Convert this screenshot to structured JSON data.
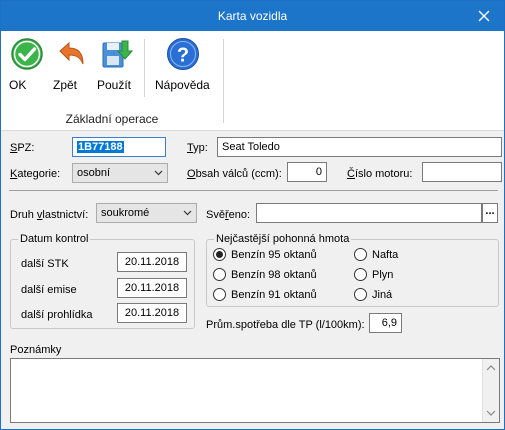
{
  "window": {
    "title": "Karta vozidla"
  },
  "toolbar": {
    "ok_label": "OK",
    "back_label": "Zpět",
    "apply_label": "Použít",
    "help_label": "Nápověda",
    "group_label": "Základní operace"
  },
  "form": {
    "spz_label": "SPZ:",
    "spz_value": "1B77188",
    "typ_label": "Typ:",
    "typ_value": "Seat Toledo",
    "kategorie_label": "Kategorie:",
    "kategorie_value": "osobní",
    "obsah_label": "Obsah válců (ccm):",
    "obsah_value": "0",
    "cislo_motoru_label": "Číslo motoru:",
    "cislo_motoru_value": "",
    "druh_label": "Druh vlastnictví:",
    "druh_value": "soukromé",
    "sevreno_label": "Svěřeno:",
    "sevreno_value": "",
    "ellipsis_label": "..."
  },
  "datum_kontrol": {
    "title": "Datum kontrol",
    "rows": [
      {
        "label": "další STK",
        "value": "20.11.2018"
      },
      {
        "label": "další emise",
        "value": "20.11.2018"
      },
      {
        "label": "další prohlídka",
        "value": "20.11.2018"
      }
    ]
  },
  "fuel": {
    "title": "Nejčastější pohonná hmota",
    "options": [
      {
        "label": "Benzín 95 oktanů",
        "selected": true
      },
      {
        "label": "Benzín 98 oktanů",
        "selected": false
      },
      {
        "label": "Benzín 91 oktanů",
        "selected": false
      },
      {
        "label": "Nafta",
        "selected": false
      },
      {
        "label": "Plyn",
        "selected": false
      },
      {
        "label": "Jiná",
        "selected": false
      }
    ]
  },
  "spotreba": {
    "label": "Prům.spotřeba dle TP (l/100km):",
    "value": "6,9"
  },
  "poznamky": {
    "label": "Poznámky",
    "value": ""
  },
  "colors": {
    "titlebar": "#1c75c9",
    "ok_green": "#3bb54a",
    "help_blue": "#2a6fd6",
    "back_orange": "#e8742c"
  }
}
